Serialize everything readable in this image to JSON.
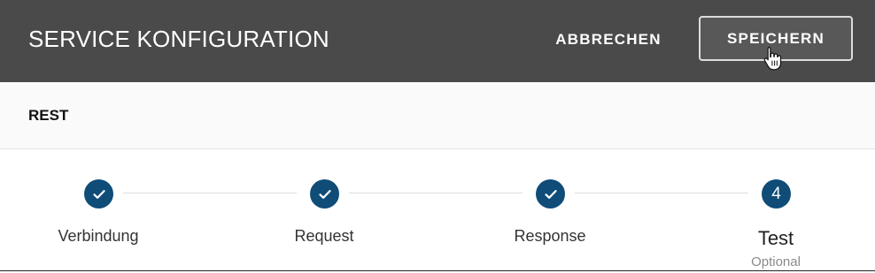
{
  "header": {
    "title": "SERVICE KONFIGURATION",
    "cancel_label": "ABBRECHEN",
    "save_label": "SPEICHERN"
  },
  "subbar": {
    "label": "REST"
  },
  "stepper": {
    "steps": [
      {
        "label": "Verbindung",
        "state": "completed",
        "icon": "check-icon"
      },
      {
        "label": "Request",
        "state": "completed",
        "icon": "check-icon"
      },
      {
        "label": "Response",
        "state": "completed",
        "icon": "check-icon"
      },
      {
        "label": "Test",
        "state": "active",
        "number": "4",
        "sublabel": "Optional"
      }
    ]
  },
  "colors": {
    "header_bg": "#4a4a4a",
    "step_circle": "#0f4c77",
    "subbar_bg": "#fafafa"
  }
}
